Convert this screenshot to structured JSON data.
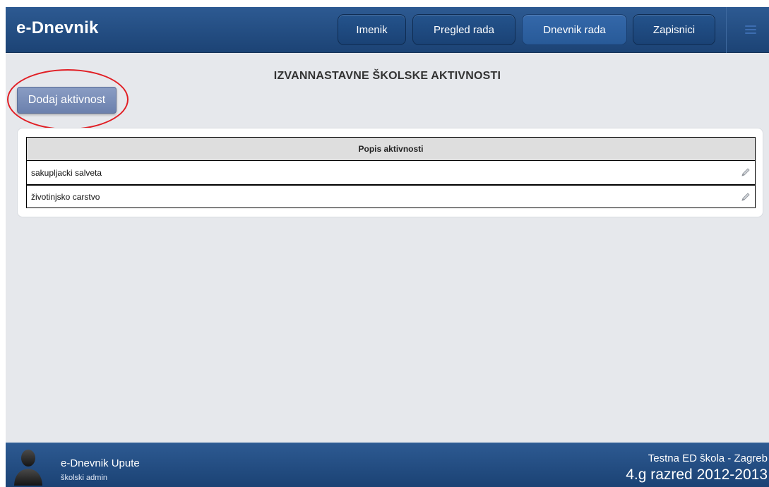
{
  "header": {
    "brand": "e-Dnevnik",
    "nav": [
      {
        "label": "Imenik",
        "active": false
      },
      {
        "label": "Pregled rada",
        "active": false
      },
      {
        "label": "Dnevnik rada",
        "active": true
      },
      {
        "label": "Zapisnici",
        "active": false
      }
    ],
    "menu_icon": "hamburger-menu-icon"
  },
  "main": {
    "title": "IZVANNASTAVNE ŠKOLSKE AKTIVNOSTI",
    "add_button_label": "Dodaj aktivnost",
    "table": {
      "header": "Popis aktivnosti",
      "rows": [
        {
          "name": "sakupljacki salveta",
          "action_icon": "pencil-icon"
        },
        {
          "name": "životinjsko carstvo",
          "action_icon": "pencil-icon"
        }
      ]
    }
  },
  "footer": {
    "user_name": "e-Dnevnik Upute",
    "user_role": "školski admin",
    "school": "Testna ED škola - Zagreb",
    "class_year": "4.g razred 2012-2013",
    "avatar_icon": "user-silhouette-icon"
  },
  "colors": {
    "header_bg": "#1c4375",
    "active_tab": "#3468aa",
    "button_accent": "#7a8fbb",
    "highlight_ring": "#e11e24",
    "page_bg": "#e6e8ec"
  }
}
